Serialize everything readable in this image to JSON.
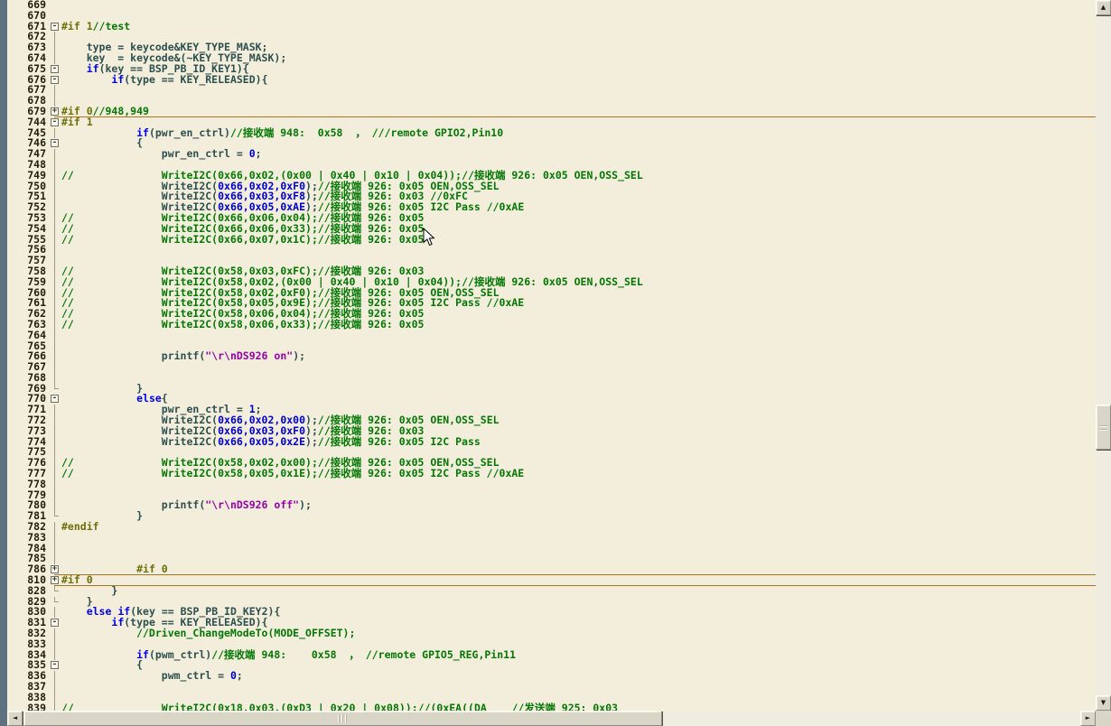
{
  "colors": {
    "bg": "#f2eedb",
    "id": "#2d4f4f",
    "kw": "#0000ee",
    "num": "#0000d4",
    "com": "#047804",
    "str": "#9a00a8",
    "pre": "#6f6f0a",
    "rule": "#a8741f",
    "ln": "#23200f"
  },
  "scrollbar": {
    "up": "▲",
    "down": "▼",
    "left": "◄",
    "right": "►"
  },
  "editor": {
    "lines": [
      {
        "n": 669,
        "m": "",
        "s": []
      },
      {
        "n": 670,
        "m": "",
        "s": []
      },
      {
        "n": 671,
        "m": "-",
        "s": [
          [
            "#if 1",
            "pre"
          ],
          [
            "//test",
            "com"
          ]
        ]
      },
      {
        "n": 672,
        "m": "|",
        "s": []
      },
      {
        "n": 673,
        "m": "|",
        "s": [
          [
            "    type = keycode&KEY_TYPE_MASK;",
            "id"
          ]
        ]
      },
      {
        "n": 674,
        "m": "|",
        "s": [
          [
            "    key  = keycode&(~KEY_TYPE_MASK);",
            "id"
          ]
        ]
      },
      {
        "n": 675,
        "m": "-",
        "s": [
          [
            "    ",
            "id"
          ],
          [
            "if",
            "kw"
          ],
          [
            "(key == BSP_PB_ID_KEY1){",
            "id"
          ]
        ]
      },
      {
        "n": 676,
        "m": "-",
        "s": [
          [
            "        ",
            "id"
          ],
          [
            "if",
            "kw"
          ],
          [
            "(type == KEY_RELEASED){",
            "id"
          ]
        ]
      },
      {
        "n": 677,
        "m": "|",
        "s": []
      },
      {
        "n": 678,
        "m": "|",
        "s": []
      },
      {
        "n": 679,
        "m": "+",
        "r": true,
        "s": [
          [
            "#if 0",
            "pre"
          ],
          [
            "//948,949",
            "com"
          ]
        ]
      },
      {
        "n": 744,
        "m": "-",
        "s": [
          [
            "#if 1",
            "pre"
          ]
        ]
      },
      {
        "n": 745,
        "m": "|",
        "s": [
          [
            "            ",
            "id"
          ],
          [
            "if",
            "kw"
          ],
          [
            "(pwr_en_ctrl)",
            "id"
          ],
          [
            "//接收端 948:  0x58  ， ///remote GPIO2,Pin10",
            "com"
          ]
        ]
      },
      {
        "n": 746,
        "m": "-",
        "s": [
          [
            "            {",
            "id"
          ]
        ]
      },
      {
        "n": 747,
        "m": "|",
        "s": [
          [
            "                pwr_en_ctrl = ",
            "id"
          ],
          [
            "0",
            "num"
          ],
          [
            ";",
            "id"
          ]
        ]
      },
      {
        "n": 748,
        "m": "|",
        "s": []
      },
      {
        "n": 749,
        "m": "|",
        "s": [
          [
            "//              WriteI2C(0x66,0x02,(0x00 | 0x40 | 0x10 | 0x04));//接收端 926: 0x05 OEN,OSS_SEL",
            "com"
          ]
        ]
      },
      {
        "n": 750,
        "m": "|",
        "s": [
          [
            "                WriteI2C(",
            "id"
          ],
          [
            "0x66,0x02,0xF0",
            "num"
          ],
          [
            ");",
            "id"
          ],
          [
            "//接收端 926: 0x05 OEN,OSS_SEL",
            "com"
          ]
        ]
      },
      {
        "n": 751,
        "m": "|",
        "s": [
          [
            "                WriteI2C(",
            "id"
          ],
          [
            "0x66,0x03,0xF8",
            "num"
          ],
          [
            ");",
            "id"
          ],
          [
            "//接收端 926: 0x03 //0xFC",
            "com"
          ]
        ]
      },
      {
        "n": 752,
        "m": "|",
        "s": [
          [
            "                WriteI2C(",
            "id"
          ],
          [
            "0x66,0x05,0xAE",
            "num"
          ],
          [
            ");",
            "id"
          ],
          [
            "//接收端 926: 0x05 I2C Pass //0xAE",
            "com"
          ]
        ]
      },
      {
        "n": 753,
        "m": "|",
        "s": [
          [
            "//              WriteI2C(0x66,0x06,0x04);//接收端 926: 0x05",
            "com"
          ]
        ]
      },
      {
        "n": 754,
        "m": "|",
        "s": [
          [
            "//              WriteI2C(0x66,0x06,0x33);//接收端 926: 0x05",
            "com"
          ]
        ]
      },
      {
        "n": 755,
        "m": "|",
        "s": [
          [
            "//              WriteI2C(0x66,0x07,0x1C);//接收端 926: 0x05",
            "com"
          ]
        ]
      },
      {
        "n": 756,
        "m": "|",
        "s": []
      },
      {
        "n": 757,
        "m": "|",
        "s": []
      },
      {
        "n": 758,
        "m": "|",
        "s": [
          [
            "//              WriteI2C(0x58,0x03,0xFC);//接收端 926: 0x03",
            "com"
          ]
        ]
      },
      {
        "n": 759,
        "m": "|",
        "s": [
          [
            "//              WriteI2C(0x58,0x02,(0x00 | 0x40 | 0x10 | 0x04));//接收端 926: 0x05 OEN,OSS_SEL",
            "com"
          ]
        ]
      },
      {
        "n": 760,
        "m": "|",
        "s": [
          [
            "//              WriteI2C(0x58,0x02,0xF0);//接收端 926: 0x05 OEN,OSS_SEL",
            "com"
          ]
        ]
      },
      {
        "n": 761,
        "m": "|",
        "s": [
          [
            "//              WriteI2C(0x58,0x05,0x9E);//接收端 926: 0x05 I2C Pass //0xAE",
            "com"
          ]
        ]
      },
      {
        "n": 762,
        "m": "|",
        "s": [
          [
            "//              WriteI2C(0x58,0x06,0x04);//接收端 926: 0x05",
            "com"
          ]
        ]
      },
      {
        "n": 763,
        "m": "|",
        "s": [
          [
            "//              WriteI2C(0x58,0x06,0x33);//接收端 926: 0x05",
            "com"
          ]
        ]
      },
      {
        "n": 764,
        "m": "|",
        "s": []
      },
      {
        "n": 765,
        "m": "|",
        "s": []
      },
      {
        "n": 766,
        "m": "|",
        "s": [
          [
            "                printf(",
            "id"
          ],
          [
            "\"\\r\\nDS926 on\"",
            "str"
          ],
          [
            ");",
            "id"
          ]
        ]
      },
      {
        "n": 767,
        "m": "|",
        "s": []
      },
      {
        "n": 768,
        "m": "|",
        "s": []
      },
      {
        "n": 769,
        "m": "L",
        "s": [
          [
            "            }",
            "id"
          ]
        ]
      },
      {
        "n": 770,
        "m": "-",
        "s": [
          [
            "            ",
            "id"
          ],
          [
            "else",
            "kw"
          ],
          [
            "{",
            "id"
          ]
        ]
      },
      {
        "n": 771,
        "m": "|",
        "s": [
          [
            "                pwr_en_ctrl = ",
            "id"
          ],
          [
            "1",
            "num"
          ],
          [
            ";",
            "id"
          ]
        ]
      },
      {
        "n": 772,
        "m": "|",
        "s": [
          [
            "                WriteI2C(",
            "id"
          ],
          [
            "0x66,0x02,0x00",
            "num"
          ],
          [
            ");",
            "id"
          ],
          [
            "//接收端 926: 0x05 OEN,OSS_SEL",
            "com"
          ]
        ]
      },
      {
        "n": 773,
        "m": "|",
        "s": [
          [
            "                WriteI2C(",
            "id"
          ],
          [
            "0x66,0x03,0xF0",
            "num"
          ],
          [
            ");",
            "id"
          ],
          [
            "//接收端 926: 0x03",
            "com"
          ]
        ]
      },
      {
        "n": 774,
        "m": "|",
        "s": [
          [
            "                WriteI2C(",
            "id"
          ],
          [
            "0x66,0x05,0x2E",
            "num"
          ],
          [
            ");",
            "id"
          ],
          [
            "//接收端 926: 0x05 I2C Pass",
            "com"
          ]
        ]
      },
      {
        "n": 775,
        "m": "|",
        "s": []
      },
      {
        "n": 776,
        "m": "|",
        "s": [
          [
            "//              WriteI2C(0x58,0x02,0x00);//接收端 926: 0x05 OEN,OSS_SEL",
            "com"
          ]
        ]
      },
      {
        "n": 777,
        "m": "|",
        "s": [
          [
            "//              WriteI2C(0x58,0x05,0x1E);//接收端 926: 0x05 I2C Pass //0xAE",
            "com"
          ]
        ]
      },
      {
        "n": 778,
        "m": "|",
        "s": []
      },
      {
        "n": 779,
        "m": "|",
        "s": []
      },
      {
        "n": 780,
        "m": "|",
        "s": [
          [
            "                printf(",
            "id"
          ],
          [
            "\"\\r\\nDS926 off\"",
            "str"
          ],
          [
            ");",
            "id"
          ]
        ]
      },
      {
        "n": 781,
        "m": "L",
        "s": [
          [
            "            }",
            "id"
          ]
        ]
      },
      {
        "n": 782,
        "m": "|",
        "s": [
          [
            "#endif",
            "pre"
          ]
        ]
      },
      {
        "n": 783,
        "m": "|",
        "s": []
      },
      {
        "n": 784,
        "m": "|",
        "s": []
      },
      {
        "n": 785,
        "m": "|",
        "s": []
      },
      {
        "n": 786,
        "m": "+",
        "r": true,
        "s": [
          [
            "            ",
            "id"
          ],
          [
            "#if 0",
            "pre"
          ]
        ]
      },
      {
        "n": 810,
        "m": "+",
        "r": true,
        "s": [
          [
            "#if 0",
            "pre"
          ]
        ]
      },
      {
        "n": 828,
        "m": "L",
        "s": [
          [
            "        }",
            "id"
          ]
        ]
      },
      {
        "n": 829,
        "m": "L",
        "s": [
          [
            "    }",
            "id"
          ]
        ]
      },
      {
        "n": 830,
        "m": "|",
        "s": [
          [
            "    ",
            "id"
          ],
          [
            "else",
            "kw"
          ],
          [
            " ",
            "id"
          ],
          [
            "if",
            "kw"
          ],
          [
            "(key == BSP_PB_ID_KEY2){",
            "id"
          ]
        ]
      },
      {
        "n": 831,
        "m": "-",
        "s": [
          [
            "        ",
            "id"
          ],
          [
            "if",
            "kw"
          ],
          [
            "(type == KEY_RELEASED){",
            "id"
          ]
        ]
      },
      {
        "n": 832,
        "m": "|",
        "s": [
          [
            "            //Driven_ChangeModeTo(MODE_OFFSET);",
            "com"
          ]
        ]
      },
      {
        "n": 833,
        "m": "|",
        "s": []
      },
      {
        "n": 834,
        "m": "|",
        "s": [
          [
            "            ",
            "id"
          ],
          [
            "if",
            "kw"
          ],
          [
            "(pwm_ctrl)",
            "id"
          ],
          [
            "//接收端 948:    0x58  ， //remote GPIO5_REG,Pin11",
            "com"
          ]
        ]
      },
      {
        "n": 835,
        "m": "-",
        "s": [
          [
            "            {",
            "id"
          ]
        ]
      },
      {
        "n": 836,
        "m": "|",
        "s": [
          [
            "                pwm_ctrl = ",
            "id"
          ],
          [
            "0",
            "num"
          ],
          [
            ";",
            "id"
          ]
        ]
      },
      {
        "n": 837,
        "m": "|",
        "s": []
      },
      {
        "n": 838,
        "m": "|",
        "s": []
      },
      {
        "n": 839,
        "m": "|",
        "s": [
          [
            "//              WriteI2C(0x18,0x03,(0xD3 | 0x20 | 0x08));//(0xEA((DA    //发送端 925: 0x03",
            "com"
          ]
        ]
      }
    ]
  }
}
